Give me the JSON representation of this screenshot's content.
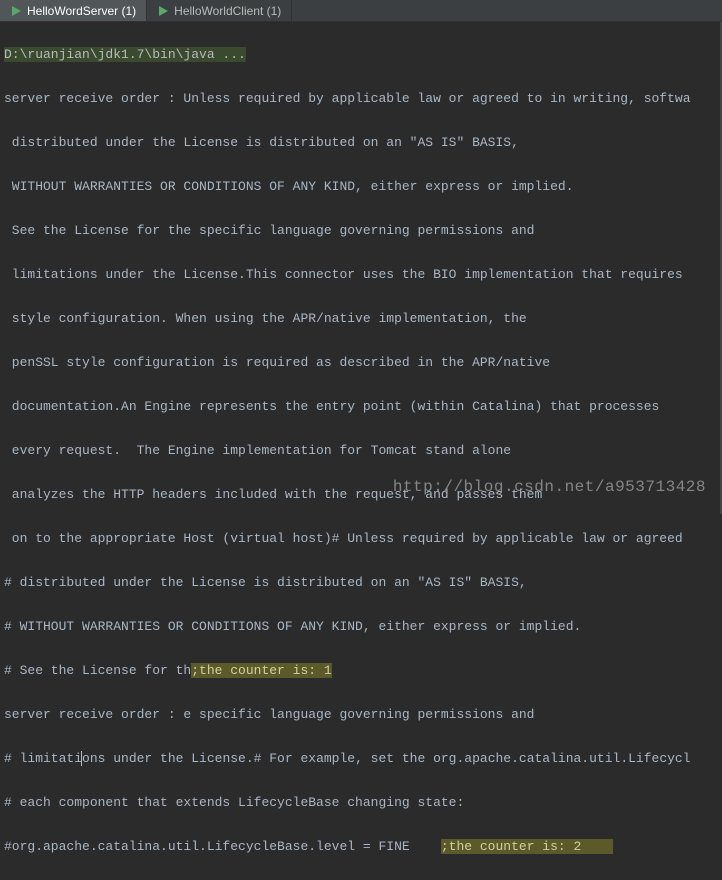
{
  "tabs": [
    {
      "label": "HelloWordServer (1)",
      "active": true
    },
    {
      "label": "HelloWorldClient (1)",
      "active": false
    }
  ],
  "cmdline": "D:\\ruanjian\\jdk1.7\\bin\\java ...",
  "lines": {
    "l1": "server receive order : Unless required by applicable law or agreed to in writing, softwa",
    "l2": " distributed under the License is distributed on an \"AS IS\" BASIS,",
    "l3": " WITHOUT WARRANTIES OR CONDITIONS OF ANY KIND, either express or implied.",
    "l4": " See the License for the specific language governing permissions and",
    "l5": " limitations under the License.This connector uses the BIO implementation that requires",
    "l6": " style configuration. When using the APR/native implementation, the",
    "l7": " penSSL style configuration is required as described in the APR/native",
    "l8": " documentation.An Engine represents the entry point (within Catalina) that processes",
    "l9": " every request.  The Engine implementation for Tomcat stand alone",
    "l10": " analyzes the HTTP headers included with the request, and passes them",
    "l11": " on to the appropriate Host (virtual host)# Unless required by applicable law or agreed",
    "l12": "# distributed under the License is distributed on an \"AS IS\" BASIS,",
    "l13": "# WITHOUT WARRANTIES OR CONDITIONS OF ANY KIND, either express or implied.",
    "l14a": "# See the License for th",
    "l14hl": ";the counter is: 1",
    "l15": "server receive order : e specific language governing permissions and",
    "l16a": "# limitati",
    "l16b": "ns under the License.# For example, set the org.apache.catalina.util.Lifecycl",
    "l17": "# each component that extends LifecycleBase changing state:",
    "l18a": "#org.apache.catalina.util.LifecycleBase.level = FINE    ",
    "l18hl": ";the counter is: 2    "
  },
  "watermark": "http://blog.csdn.net/a953713428"
}
